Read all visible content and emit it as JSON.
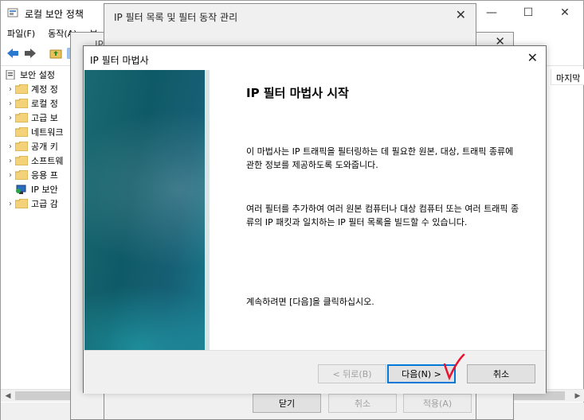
{
  "main_window": {
    "title": "로컬 보안 정책",
    "controls": {
      "minimize": "—",
      "maximize": "☐",
      "close": "✕"
    },
    "menu": [
      "파일(F)",
      "동작(A)",
      "보"
    ],
    "tree": [
      {
        "label": "보안 설정",
        "chevron": ""
      },
      {
        "label": "계정 정",
        "chevron": "›"
      },
      {
        "label": "로컬 정",
        "chevron": "›"
      },
      {
        "label": "고급 보",
        "chevron": "›"
      },
      {
        "label": "네트워크",
        "chevron": ""
      },
      {
        "label": "공개 키",
        "chevron": "›"
      },
      {
        "label": "소프트웨",
        "chevron": "›"
      },
      {
        "label": "응용 프",
        "chevron": "›"
      },
      {
        "label": "IP 보안",
        "chevron": ""
      },
      {
        "label": "고급 감",
        "chevron": "›"
      }
    ],
    "right_header": "마지막"
  },
  "filter_list_dialog": {
    "title": "IP 필터 목록",
    "close": "✕"
  },
  "manage_dialog": {
    "title": "IP 필터 목록 및 필터 동작 관리",
    "close": "✕",
    "buttons": {
      "close": "닫기",
      "cancel": "취소",
      "apply": "적용(A)"
    }
  },
  "wizard": {
    "title": "IP 필터 마법사",
    "close": "✕",
    "heading": "IP 필터 마법사 시작",
    "para1": "이 마법사는 IP 트래픽을 필터링하는 데 필요한 원본, 대상, 트래픽 종류에 관한 정보를 제공하도록 도와줍니다.",
    "para2": "여러 필터를 추가하여 여러 원본 컴퓨터나 대상 컴퓨터 또는 여러 트래픽 종류의 IP 패킷과 일치하는 IP 필터 목록을 빌드할 수 있습니다.",
    "para3": "계속하려면 [다음]을 클릭하십시오.",
    "buttons": {
      "back": "< 뒤로(B)",
      "next": "다음(N) >",
      "cancel": "취소"
    }
  },
  "colors": {
    "accent": "#0078d7",
    "banner": "#0f5a67",
    "annotation": "#e8112d"
  }
}
